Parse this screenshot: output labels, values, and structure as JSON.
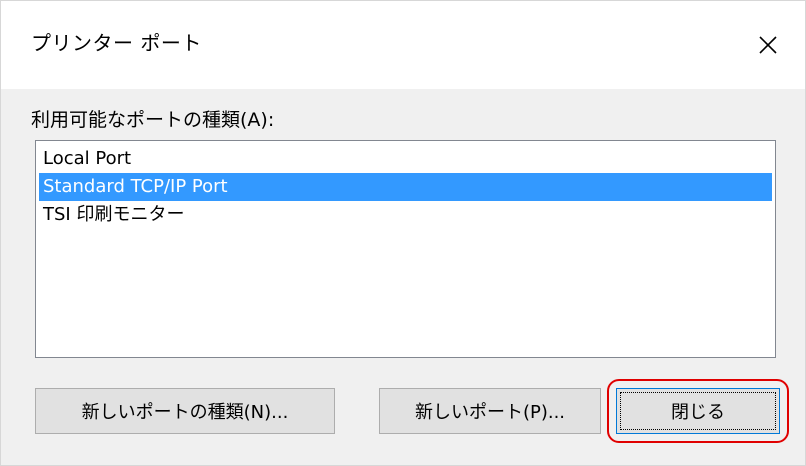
{
  "window": {
    "title": "プリンター ポート",
    "close_icon": "close-icon"
  },
  "port_types": {
    "label": "利用可能なポートの種類(A):",
    "items": [
      {
        "label": "Local Port",
        "selected": false
      },
      {
        "label": "Standard TCP/IP Port",
        "selected": true
      },
      {
        "label": "TSI 印刷モニター",
        "selected": false
      }
    ]
  },
  "buttons": {
    "new_port_type": "新しいポートの種類(N)...",
    "new_port": "新しいポート(P)...",
    "close": "閉じる"
  },
  "colors": {
    "selection": "#3399ff",
    "highlight": "#e00000",
    "dialog_bg": "#f0f0f0"
  }
}
